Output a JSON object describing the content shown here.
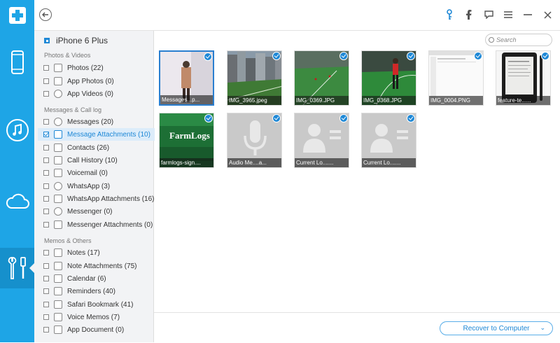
{
  "device": {
    "name": "iPhone 6 Plus"
  },
  "sidebar": {
    "sections": [
      {
        "title": "Photos & Videos"
      },
      {
        "title": "Messages & Call log"
      },
      {
        "title": "Memos & Others"
      }
    ],
    "items": [
      {
        "label": "Photos (22)"
      },
      {
        "label": "App Photos (0)"
      },
      {
        "label": "App Videos (0)"
      },
      {
        "label": "Messages (20)"
      },
      {
        "label": "Message Attachments (10)"
      },
      {
        "label": "Contacts (26)"
      },
      {
        "label": "Call History (10)"
      },
      {
        "label": "Voicemail (0)"
      },
      {
        "label": "WhatsApp (3)"
      },
      {
        "label": "WhatsApp Attachments (16)"
      },
      {
        "label": "Messenger (0)"
      },
      {
        "label": "Messenger Attachments (0)"
      },
      {
        "label": "Notes (17)"
      },
      {
        "label": "Note Attachments (75)"
      },
      {
        "label": "Calendar (6)"
      },
      {
        "label": "Reminders (40)"
      },
      {
        "label": "Safari Bookmark (41)"
      },
      {
        "label": "Voice Memos (7)"
      },
      {
        "label": "App Document (0)"
      }
    ]
  },
  "search": {
    "placeholder": "Search"
  },
  "thumbnails": [
    {
      "caption": "Messages...p..."
    },
    {
      "caption": "IMG_3965.jpeg"
    },
    {
      "caption": "IMG_0369.JPG"
    },
    {
      "caption": "IMG_0368.JPG"
    },
    {
      "caption": "IMG_0004.PNG"
    },
    {
      "caption": "feature-te......"
    },
    {
      "caption": "farmlogs-sign...."
    },
    {
      "caption": "Audio Me....a..."
    },
    {
      "caption": "Current Lo......."
    },
    {
      "caption": "Current Lo......."
    }
  ],
  "thumb_text": {
    "farmlogs": "FarmLogs"
  },
  "footer": {
    "recover_label": "Recover to Computer"
  },
  "colors": {
    "accent": "#1ea5e6",
    "selected_text": "#1e88d6"
  }
}
